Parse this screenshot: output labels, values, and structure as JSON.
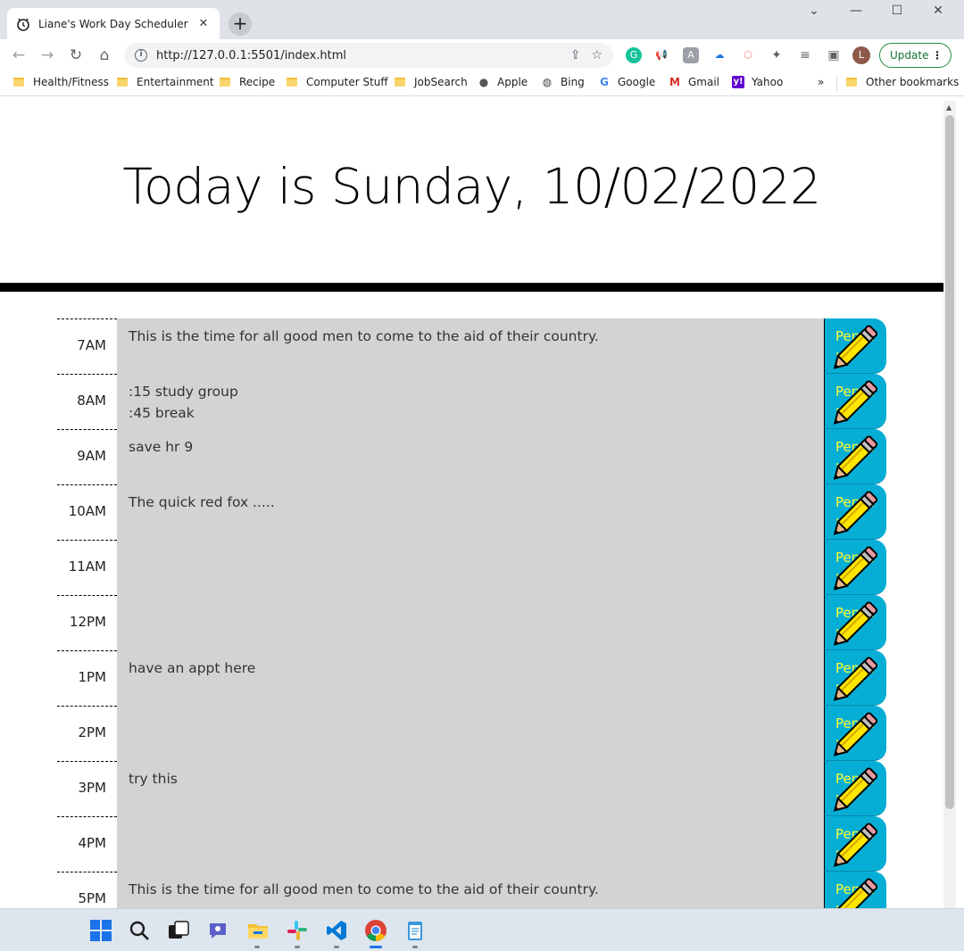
{
  "browser": {
    "tab_title": "Liane's Work Day Scheduler",
    "url": "http://127.0.0.1:5501/index.html",
    "update_label": "Update",
    "avatar_letter": "L",
    "bookmarks": [
      "Health/Fitness",
      "Entertainment",
      "Recipe",
      "Computer Stuff",
      "JobSearch",
      "Apple",
      "Bing",
      "Google",
      "Gmail",
      "Yahoo"
    ],
    "bookmarks_overflow": "»",
    "other_bookmarks": "Other bookmarks"
  },
  "page": {
    "title": "Today is Sunday, 10/02/2022"
  },
  "scheduler": {
    "save_label": "Pencil In",
    "rows": [
      {
        "hour": "7AM",
        "text": "This is the time for all good men to come to the aid of their country."
      },
      {
        "hour": "8AM",
        "text": ":15 study group\n:45 break"
      },
      {
        "hour": "9AM",
        "text": "save hr 9"
      },
      {
        "hour": "10AM",
        "text": "The quick red fox ....."
      },
      {
        "hour": "11AM",
        "text": ""
      },
      {
        "hour": "12PM",
        "text": ""
      },
      {
        "hour": "1PM",
        "text": "have an appt here"
      },
      {
        "hour": "2PM",
        "text": ""
      },
      {
        "hour": "3PM",
        "text": "try this"
      },
      {
        "hour": "4PM",
        "text": ""
      },
      {
        "hour": "5PM",
        "text": "This is the time for all good men to come to the aid of their country."
      }
    ]
  },
  "colors": {
    "save_bg": "#06aed5",
    "save_text": "#ffff33",
    "textarea_bg": "#d3d3d3"
  }
}
